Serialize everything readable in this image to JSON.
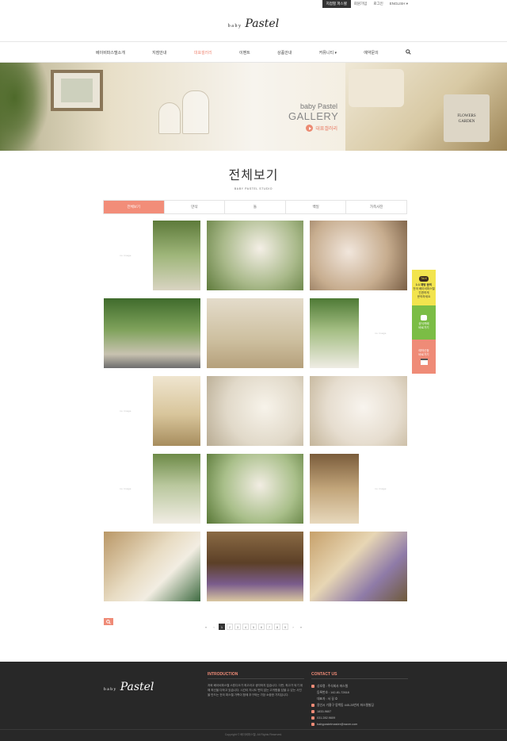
{
  "topbar": {
    "links": [
      "지점별 파스텔",
      "회원가입",
      "로그인",
      "ENGLISH ▾"
    ]
  },
  "logo": {
    "small": "baby",
    "script": "Pastel"
  },
  "nav": {
    "items": [
      "베이비파스텔소개",
      "지점안내",
      "대표갤러리",
      "이벤트",
      "상품안내",
      "커뮤니티 ▾",
      "예약문의"
    ],
    "active_index": 2
  },
  "banner": {
    "title_small": "baby Pastel",
    "title_big": "GALLERY",
    "link_label": "대표갤러리",
    "pot_text": "FLOWERS GARDEN"
  },
  "heading": {
    "title": "전체보기",
    "subtitle": "BABY PASTEL STUDIO"
  },
  "tabs": [
    "전체보기",
    "만삭",
    "돌",
    "백일",
    "가족사진"
  ],
  "side_widgets": {
    "kakao": {
      "badge": "TALK",
      "lines": [
        "1:1 채팅 문의",
        "전국 베이비파스텔",
        "간편하게",
        "문의하세요"
      ]
    },
    "cafe": {
      "lines": [
        "공식카페",
        "바로가기"
      ]
    },
    "reserve": {
      "lines": [
        "예약신청",
        "바로가기"
      ]
    }
  },
  "gallery": {
    "placeholder_label": "no image"
  },
  "pager": {
    "prev2": "«",
    "prev": "‹",
    "pages": [
      "1",
      "2",
      "3",
      "4",
      "5",
      "6",
      "7",
      "8",
      "9"
    ],
    "current": "1",
    "next": "›",
    "next2": "»"
  },
  "footer": {
    "intro_title": "INTRODUCTION",
    "intro_text": "저희 베이비파스텔 스튜디오가 최고라고 생각하지 않습니다. 다만, 최고가 되기 위해 최선을 다하고 있습니다. 시간이 지나도 변치 않는 고귀함을 담을 수 있는 사진을 만드는 전국 파스텔 가족이 함께 추구하는 가장 소중한 가치입니다.",
    "contact_title": "CONTACT US",
    "contact": [
      "상호명 : 주식회사 파스텔",
      "등록번호 : 142-81-72618",
      "대표자 : 서 길 호",
      "용인시 기흥구 동백동 445-25번지 파스텔빌딩",
      "1833-9607",
      "031.282.9609",
      "babypastelmaster@naver.com"
    ],
    "copyright": "Copyright © 베이비파스텔. All Rights Reserved."
  },
  "colors": {
    "accent": "#ef8b77",
    "footer_bg": "#282828"
  }
}
